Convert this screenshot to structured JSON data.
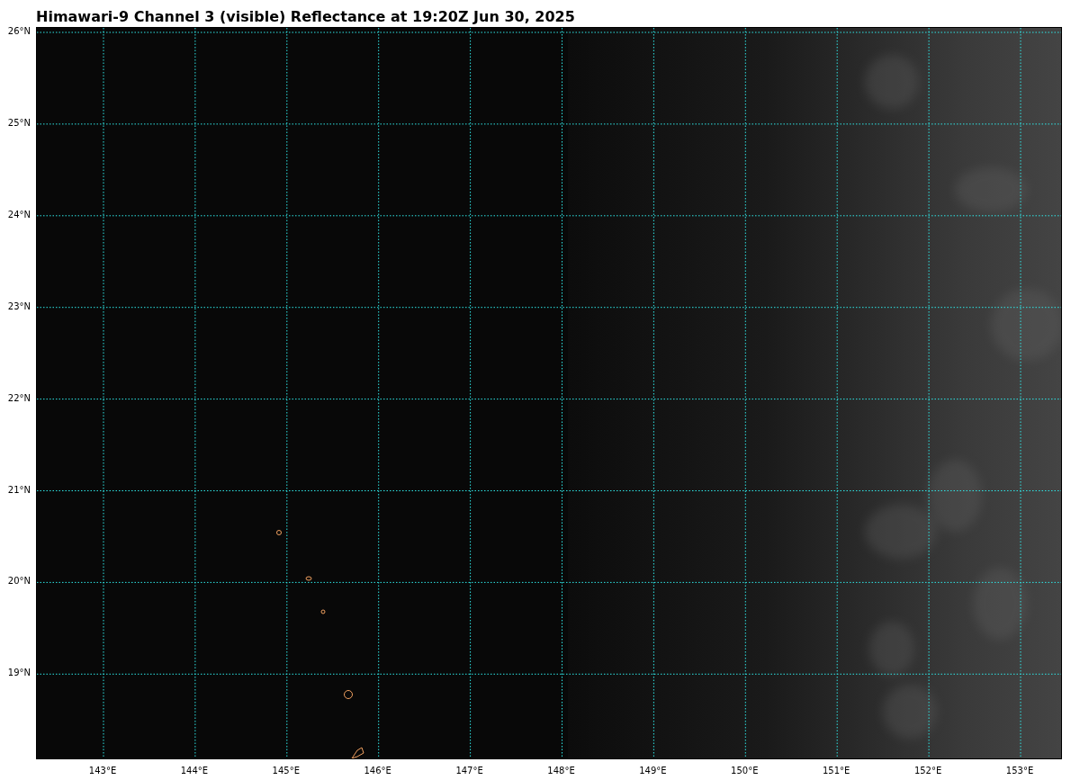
{
  "title": "Himawari-9 Channel 3 (visible) Reflectance at 19:20Z Jun 30, 2025",
  "map": {
    "xticks": [
      "143°E",
      "144°E",
      "145°E",
      "146°E",
      "147°E",
      "148°E",
      "149°E",
      "150°E",
      "151°E",
      "152°E",
      "153°E"
    ],
    "yticks": [
      "26°N",
      "25°N",
      "24°N",
      "23°N",
      "22°N",
      "21°N",
      "20°N",
      "19°N"
    ]
  }
}
